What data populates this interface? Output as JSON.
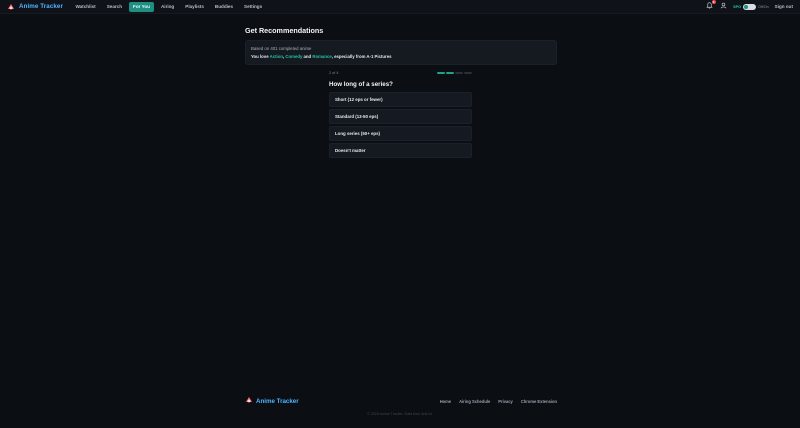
{
  "nav": {
    "brand": "Anime Tracker",
    "links": [
      {
        "label": "Watchlist"
      },
      {
        "label": "Search"
      },
      {
        "label": "For You"
      },
      {
        "label": "Airing"
      },
      {
        "label": "Playlists"
      },
      {
        "label": "Buddies"
      },
      {
        "label": "Settings"
      }
    ],
    "active_link": "For You",
    "notification_count": "3",
    "spoiler_label": "SPO",
    "spoiler_state": "Off/On",
    "sign_out": "Sign out",
    "icons": [
      "bell-icon",
      "user-icon"
    ]
  },
  "page": {
    "title": "Get Recommendations",
    "summary": {
      "line1": "Based on 401 completed anime",
      "you_love": "You love ",
      "genre1": "Action",
      "sep1": ", ",
      "genre2": "Comedy",
      "and": " and ",
      "genre3": "Romance",
      "especially": ", especially from A-1 Pictures"
    }
  },
  "quiz": {
    "step": "2 of 4",
    "progress": {
      "current": 2,
      "total": 4
    },
    "question": "How long of a series?",
    "options": [
      "Short (12 eps or fewer)",
      "Standard (13-50 eps)",
      "Long series (50+ eps)",
      "Doesn't matter"
    ]
  },
  "footer": {
    "brand": "Anime Tracker",
    "links": [
      "Home",
      "Airing Schedule",
      "Privacy",
      "Chrome Extension"
    ],
    "copyright": "© 2025 Anime Tracker. Data from AniList."
  },
  "colors": {
    "accent": "#1f8f84",
    "brand": "#4fb4ff",
    "genre": "#22c3a6",
    "background": "#0b0e13"
  }
}
